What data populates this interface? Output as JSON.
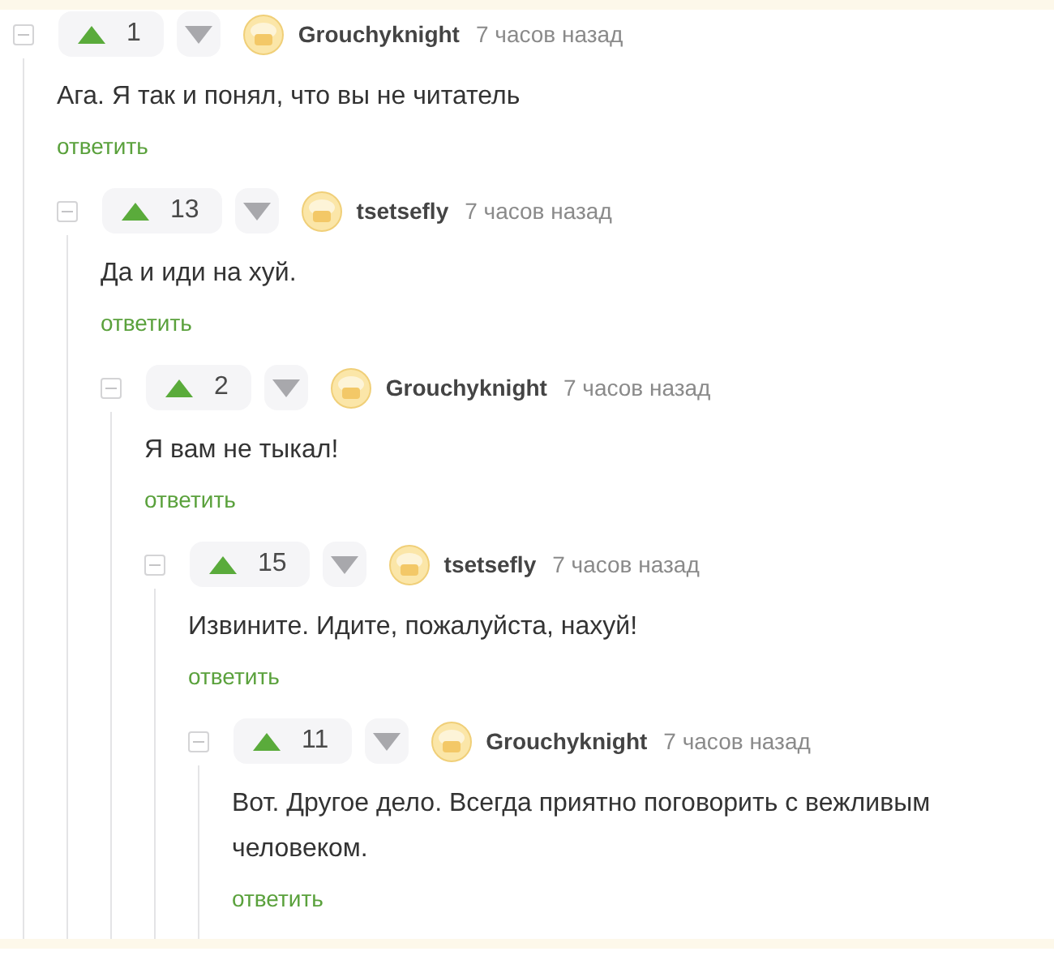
{
  "comments": [
    {
      "rating": "1",
      "author": "Grouchyknight",
      "time": "7 часов назад",
      "text": "Ага. Я так и понял, что вы не читатель",
      "reply": "ответить",
      "children": [
        {
          "rating": "13",
          "author": "tsetsefly",
          "time": "7 часов назад",
          "text": "Да и иди на хуй.",
          "reply": "ответить",
          "children": [
            {
              "rating": "2",
              "author": "Grouchyknight",
              "time": "7 часов назад",
              "text": "Я вам не тыкал!",
              "reply": "ответить",
              "children": [
                {
                  "rating": "15",
                  "author": "tsetsefly",
                  "time": "7 часов назад",
                  "text": "Извините. Идите, пожалуйста, нахуй!",
                  "reply": "ответить",
                  "children": [
                    {
                      "rating": "11",
                      "author": "Grouchyknight",
                      "time": "7 часов назад",
                      "text": "Вот. Другое дело. Всегда приятно поговорить с вежливым человеком.",
                      "reply": "ответить"
                    }
                  ]
                }
              ]
            }
          ]
        }
      ]
    }
  ]
}
